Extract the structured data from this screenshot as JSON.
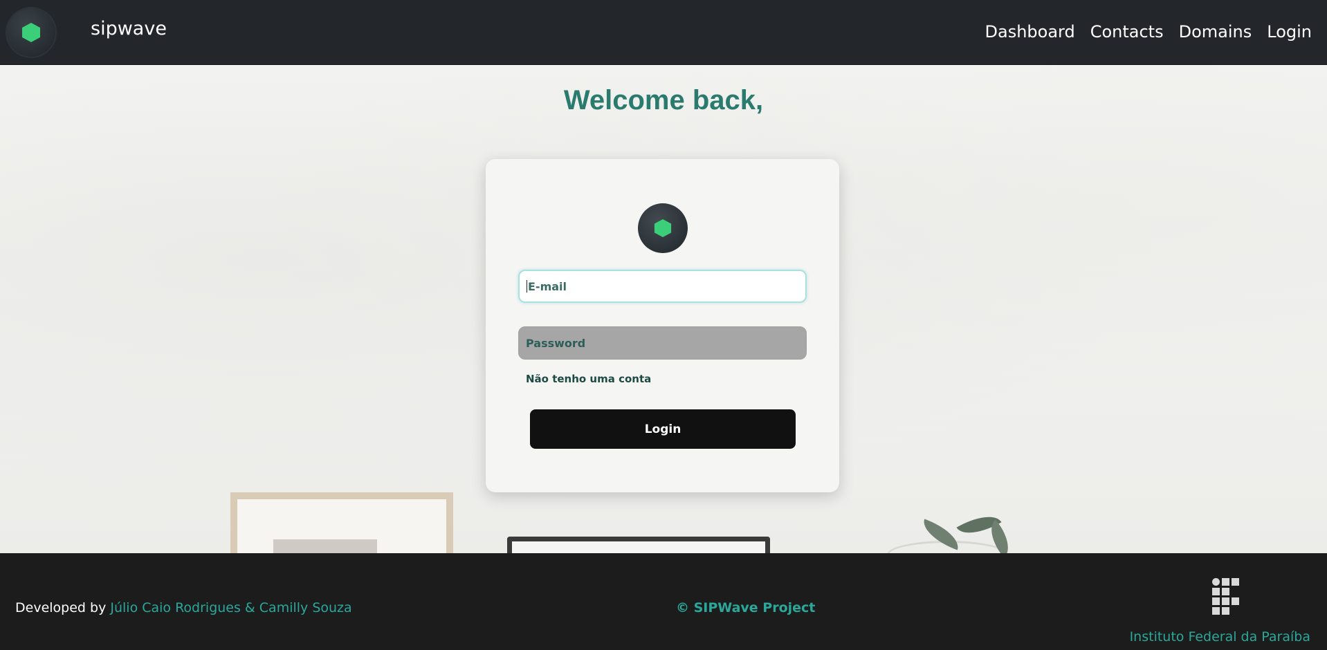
{
  "navbar": {
    "brand": "sipwave",
    "links": [
      "Dashboard",
      "Contacts",
      "Domains",
      "Login"
    ]
  },
  "hero": {
    "welcome": "Welcome back,"
  },
  "login_form": {
    "email_placeholder": "E-mail",
    "password_placeholder": "Password",
    "signup_link": "Não tenho uma conta",
    "submit_label": "Login"
  },
  "footer": {
    "developed_by": "Developed by ",
    "developers": "Júlio Caio Rodrigues & Camilly Souza",
    "copyright": "© SIPWave Project",
    "institute": "Instituto Federal da Paraíba"
  },
  "colors": {
    "accent": "#2aa89a",
    "heading": "#2a7a6e",
    "logo_hex": "#3ccf7a",
    "navbar_bg": "#23272c",
    "footer_bg": "#1c1c1d"
  },
  "icons": {
    "brand_logo": "hexagon-logo-icon",
    "card_logo": "hexagon-logo-icon",
    "institute_logo": "ifpb-logo-icon"
  }
}
